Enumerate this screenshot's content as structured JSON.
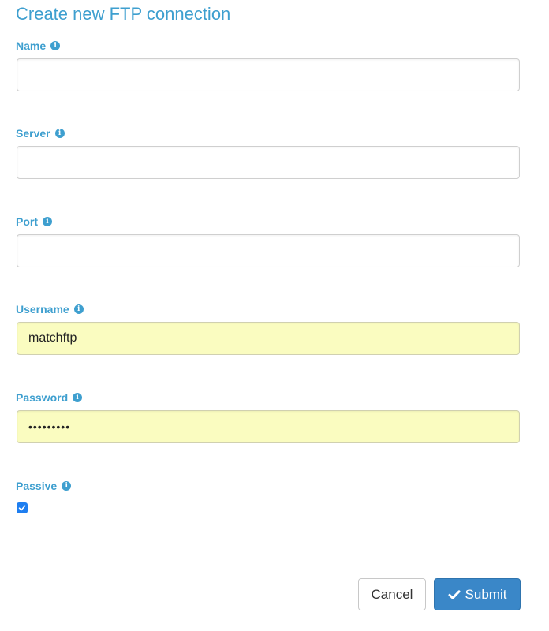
{
  "form": {
    "title": "Create new FTP connection",
    "fields": {
      "name": {
        "label": "Name",
        "value": "",
        "placeholder": ""
      },
      "server": {
        "label": "Server",
        "value": "",
        "placeholder": ""
      },
      "port": {
        "label": "Port",
        "value": "",
        "placeholder": ""
      },
      "username": {
        "label": "Username",
        "value": "matchftp",
        "placeholder": ""
      },
      "password": {
        "label": "Password",
        "value": "•••••••••",
        "placeholder": ""
      },
      "passive": {
        "label": "Passive",
        "checked": true
      }
    },
    "info_icon_glyph": "i",
    "buttons": {
      "cancel_label": "Cancel",
      "submit_label": "Submit",
      "submit_icon": "check-icon"
    }
  },
  "colors": {
    "label": "#3e9fcf",
    "autofill_bg": "#fafcc0",
    "submit_bg": "#3a87c8",
    "checkbox_bg": "#1e7ef0"
  }
}
